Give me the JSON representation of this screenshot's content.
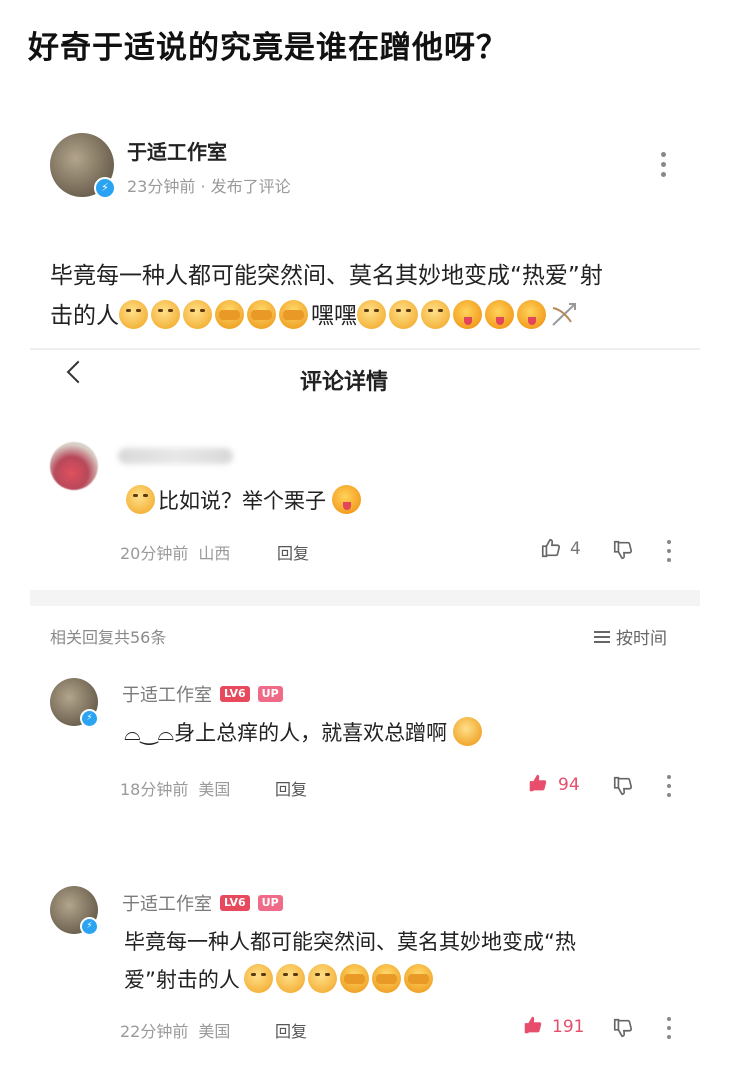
{
  "headline": "好奇于适说的究竟是谁在蹭他呀？",
  "post": {
    "author": "于适工作室",
    "meta": "23分钟前 · 发布了评论",
    "text_line1": "毕竟每一种人都可能突然间、莫名其妙地变成“热爱”射",
    "text_line2_prefix": "击的人",
    "text_line2_mid": "嘿嘿",
    "emojis": [
      "dog-emoji",
      "dog-emoji",
      "dog-emoji",
      "cover-face-emoji",
      "cover-face-emoji",
      "cover-face-emoji",
      "dog-emoji",
      "dog-emoji",
      "dog-emoji",
      "tongue-emoji",
      "tongue-emoji",
      "tongue-emoji",
      "bow-arrow-emoji"
    ]
  },
  "detail": {
    "title": "评论详情",
    "comment": {
      "text": "比如说？举个栗子",
      "time": "20分钟前",
      "location": "山西",
      "reply_label": "回复",
      "likes": "4"
    },
    "related_count": "相关回复共56条",
    "sort_label": "按时间",
    "replies": [
      {
        "author": "于适工作室",
        "level_badge": "LV6",
        "up_badge": "UP",
        "prefix": "⌓‿⌓",
        "text": "身上总痒的人，就喜欢总蹭啊",
        "time": "18分钟前",
        "location": "美国",
        "reply_label": "回复",
        "likes": "94"
      },
      {
        "author": "于适工作室",
        "level_badge": "LV6",
        "up_badge": "UP",
        "text_line1": "毕竟每一种人都可能突然间、莫名其妙地变成“热",
        "text_line2": "爱”射击的人",
        "time": "22分钟前",
        "location": "美国",
        "reply_label": "回复",
        "likes": "191"
      }
    ]
  },
  "colors": {
    "accent_like": "#e84d6b",
    "verify_blue": "#2aa3f3",
    "meta_gray": "#9a9a9a"
  }
}
